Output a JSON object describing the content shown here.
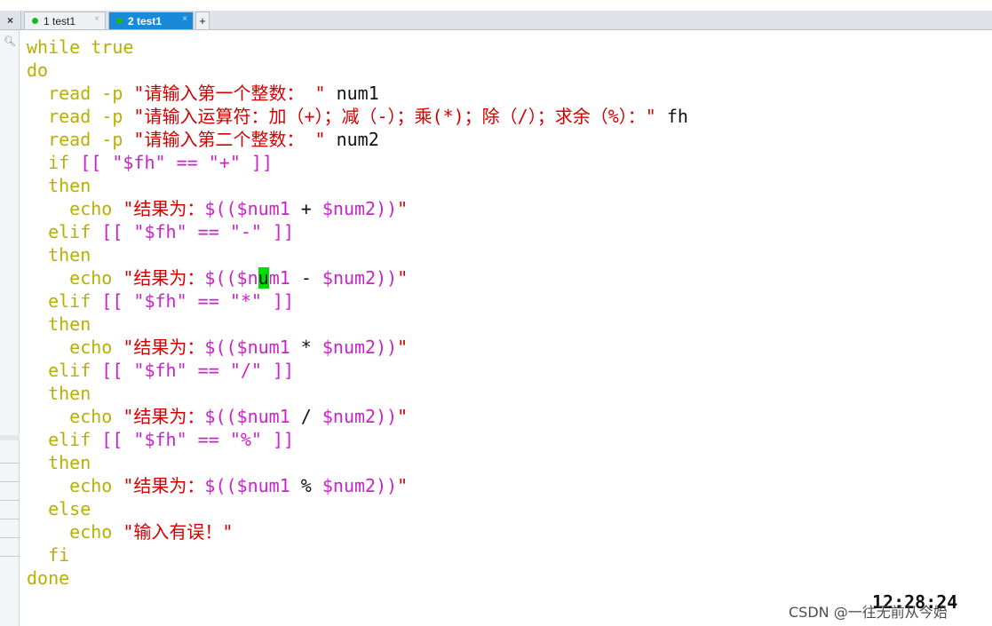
{
  "tabbar": {
    "close_all": "×",
    "tabs": [
      {
        "label": "1 test1",
        "close": "×",
        "active": false
      },
      {
        "label": "2 test1",
        "close": "×",
        "active": true
      }
    ],
    "add": "+"
  },
  "editor": {
    "lines": [
      [
        {
          "t": "while true",
          "c": "kw"
        }
      ],
      [
        {
          "t": "do",
          "c": "kw"
        }
      ],
      [
        {
          "t": "  read -p ",
          "c": "kw"
        },
        {
          "t": "\"请输入第一个整数： \"",
          "c": "str"
        },
        {
          "t": " num1",
          "c": "plain"
        }
      ],
      [
        {
          "t": "  read -p ",
          "c": "kw"
        },
        {
          "t": "\"请输入运算符：加（+）；减（-）；乘(*)；除（/）；求余（%）：\"",
          "c": "str"
        },
        {
          "t": " fh",
          "c": "plain"
        }
      ],
      [
        {
          "t": "  read -p ",
          "c": "kw"
        },
        {
          "t": "\"请输入第二个整数： \"",
          "c": "str"
        },
        {
          "t": " num2",
          "c": "plain"
        }
      ],
      [
        {
          "t": "  if ",
          "c": "kw"
        },
        {
          "t": "[[ ",
          "c": "fl"
        },
        {
          "t": "\"$fh\"",
          "c": "var"
        },
        {
          "t": " == ",
          "c": "fl"
        },
        {
          "t": "\"+\"",
          "c": "var"
        },
        {
          "t": " ]]",
          "c": "fl"
        }
      ],
      [
        {
          "t": "  then",
          "c": "kw"
        }
      ],
      [
        {
          "t": "    echo ",
          "c": "kw"
        },
        {
          "t": "\"结果为：",
          "c": "str"
        },
        {
          "t": "$(($num1",
          "c": "var"
        },
        {
          "t": " + ",
          "c": "plain"
        },
        {
          "t": "$num2))",
          "c": "var"
        },
        {
          "t": "\"",
          "c": "str"
        }
      ],
      [
        {
          "t": "  elif ",
          "c": "kw"
        },
        {
          "t": "[[ ",
          "c": "fl"
        },
        {
          "t": "\"$fh\"",
          "c": "var"
        },
        {
          "t": " == ",
          "c": "fl"
        },
        {
          "t": "\"-\"",
          "c": "var"
        },
        {
          "t": " ]]",
          "c": "fl"
        }
      ],
      [
        {
          "t": "  then",
          "c": "kw"
        }
      ],
      [
        {
          "t": "    echo ",
          "c": "kw"
        },
        {
          "t": "\"结果为：",
          "c": "str"
        },
        {
          "t": "$(($n",
          "c": "var"
        },
        {
          "t": "u",
          "c": "cursor"
        },
        {
          "t": "m1",
          "c": "var"
        },
        {
          "t": " - ",
          "c": "plain"
        },
        {
          "t": "$num2))",
          "c": "var"
        },
        {
          "t": "\"",
          "c": "str"
        }
      ],
      [
        {
          "t": "  elif ",
          "c": "kw"
        },
        {
          "t": "[[ ",
          "c": "fl"
        },
        {
          "t": "\"$fh\"",
          "c": "var"
        },
        {
          "t": " == ",
          "c": "fl"
        },
        {
          "t": "\"*\"",
          "c": "var"
        },
        {
          "t": " ]]",
          "c": "fl"
        }
      ],
      [
        {
          "t": "  then",
          "c": "kw"
        }
      ],
      [
        {
          "t": "    echo ",
          "c": "kw"
        },
        {
          "t": "\"结果为：",
          "c": "str"
        },
        {
          "t": "$(($num1",
          "c": "var"
        },
        {
          "t": " * ",
          "c": "plain"
        },
        {
          "t": "$num2))",
          "c": "var"
        },
        {
          "t": "\"",
          "c": "str"
        }
      ],
      [
        {
          "t": "  elif ",
          "c": "kw"
        },
        {
          "t": "[[ ",
          "c": "fl"
        },
        {
          "t": "\"$fh\"",
          "c": "var"
        },
        {
          "t": " == ",
          "c": "fl"
        },
        {
          "t": "\"/\"",
          "c": "var"
        },
        {
          "t": " ]]",
          "c": "fl"
        }
      ],
      [
        {
          "t": "  then",
          "c": "kw"
        }
      ],
      [
        {
          "t": "    echo ",
          "c": "kw"
        },
        {
          "t": "\"结果为：",
          "c": "str"
        },
        {
          "t": "$(($num1",
          "c": "var"
        },
        {
          "t": " / ",
          "c": "plain"
        },
        {
          "t": "$num2))",
          "c": "var"
        },
        {
          "t": "\"",
          "c": "str"
        }
      ],
      [
        {
          "t": "  elif ",
          "c": "kw"
        },
        {
          "t": "[[ ",
          "c": "fl"
        },
        {
          "t": "\"$fh\"",
          "c": "var"
        },
        {
          "t": " == ",
          "c": "fl"
        },
        {
          "t": "\"%\"",
          "c": "var"
        },
        {
          "t": " ]]",
          "c": "fl"
        }
      ],
      [
        {
          "t": "  then",
          "c": "kw"
        }
      ],
      [
        {
          "t": "    echo ",
          "c": "kw"
        },
        {
          "t": "\"结果为：",
          "c": "str"
        },
        {
          "t": "$(($num1",
          "c": "var"
        },
        {
          "t": " % ",
          "c": "plain"
        },
        {
          "t": "$num2))",
          "c": "var"
        },
        {
          "t": "\"",
          "c": "str"
        }
      ],
      [
        {
          "t": "  else",
          "c": "kw"
        }
      ],
      [
        {
          "t": "    echo ",
          "c": "kw"
        },
        {
          "t": "\"输入有误！\"",
          "c": "str"
        }
      ],
      [
        {
          "t": "  fi",
          "c": "kw"
        }
      ],
      [
        {
          "t": "done",
          "c": "kw"
        }
      ]
    ]
  },
  "status": {
    "clock": "12:28:24"
  },
  "watermark": "CSDN @一往无前从今始",
  "colors": {
    "keyword": "#b8b000",
    "string": "#d40000",
    "variable": "#cc22cc",
    "cursor": "#00dd00",
    "active_tab": "#1a8ad8"
  }
}
